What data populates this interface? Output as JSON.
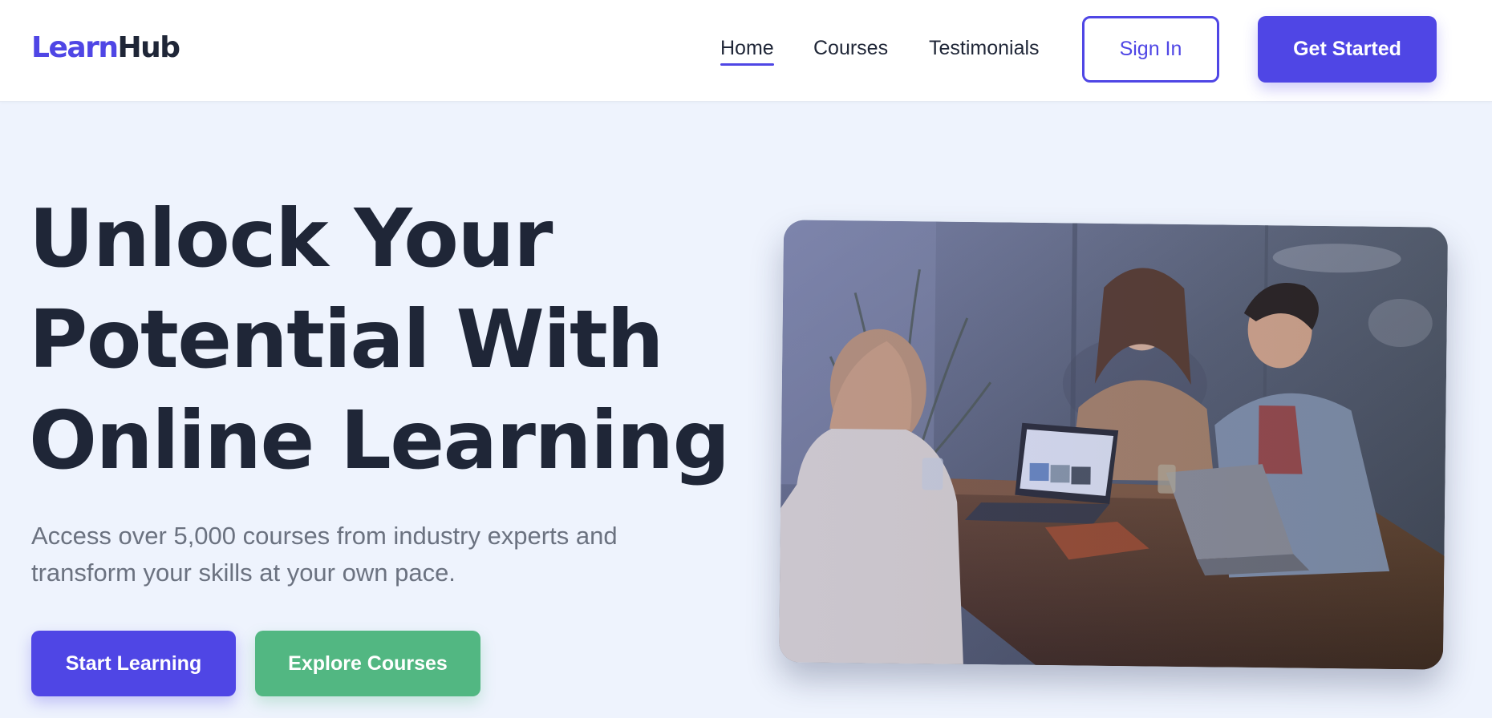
{
  "header": {
    "logo": {
      "part1": "Learn",
      "part2": "Hub"
    },
    "nav": [
      {
        "label": "Home",
        "active": true
      },
      {
        "label": "Courses",
        "active": false
      },
      {
        "label": "Testimonials",
        "active": false
      }
    ],
    "sign_in_label": "Sign In",
    "get_started_label": "Get Started"
  },
  "hero": {
    "title_lines": [
      "Unlock Your",
      "Potential With",
      "Online Learning"
    ],
    "subtitle_lines": [
      "Access over 5,000 courses from industry experts and",
      "transform your skills at your own pace."
    ],
    "primary_cta": "Start Learning",
    "secondary_cta": "Explore Courses",
    "image": "photo of three people laughing around a table with laptops"
  },
  "colors": {
    "accent": "#4f46e5",
    "secondary": "#52b782",
    "text_dark": "#1f2637",
    "text_muted": "#6b7280",
    "background": "#eef3fd"
  }
}
